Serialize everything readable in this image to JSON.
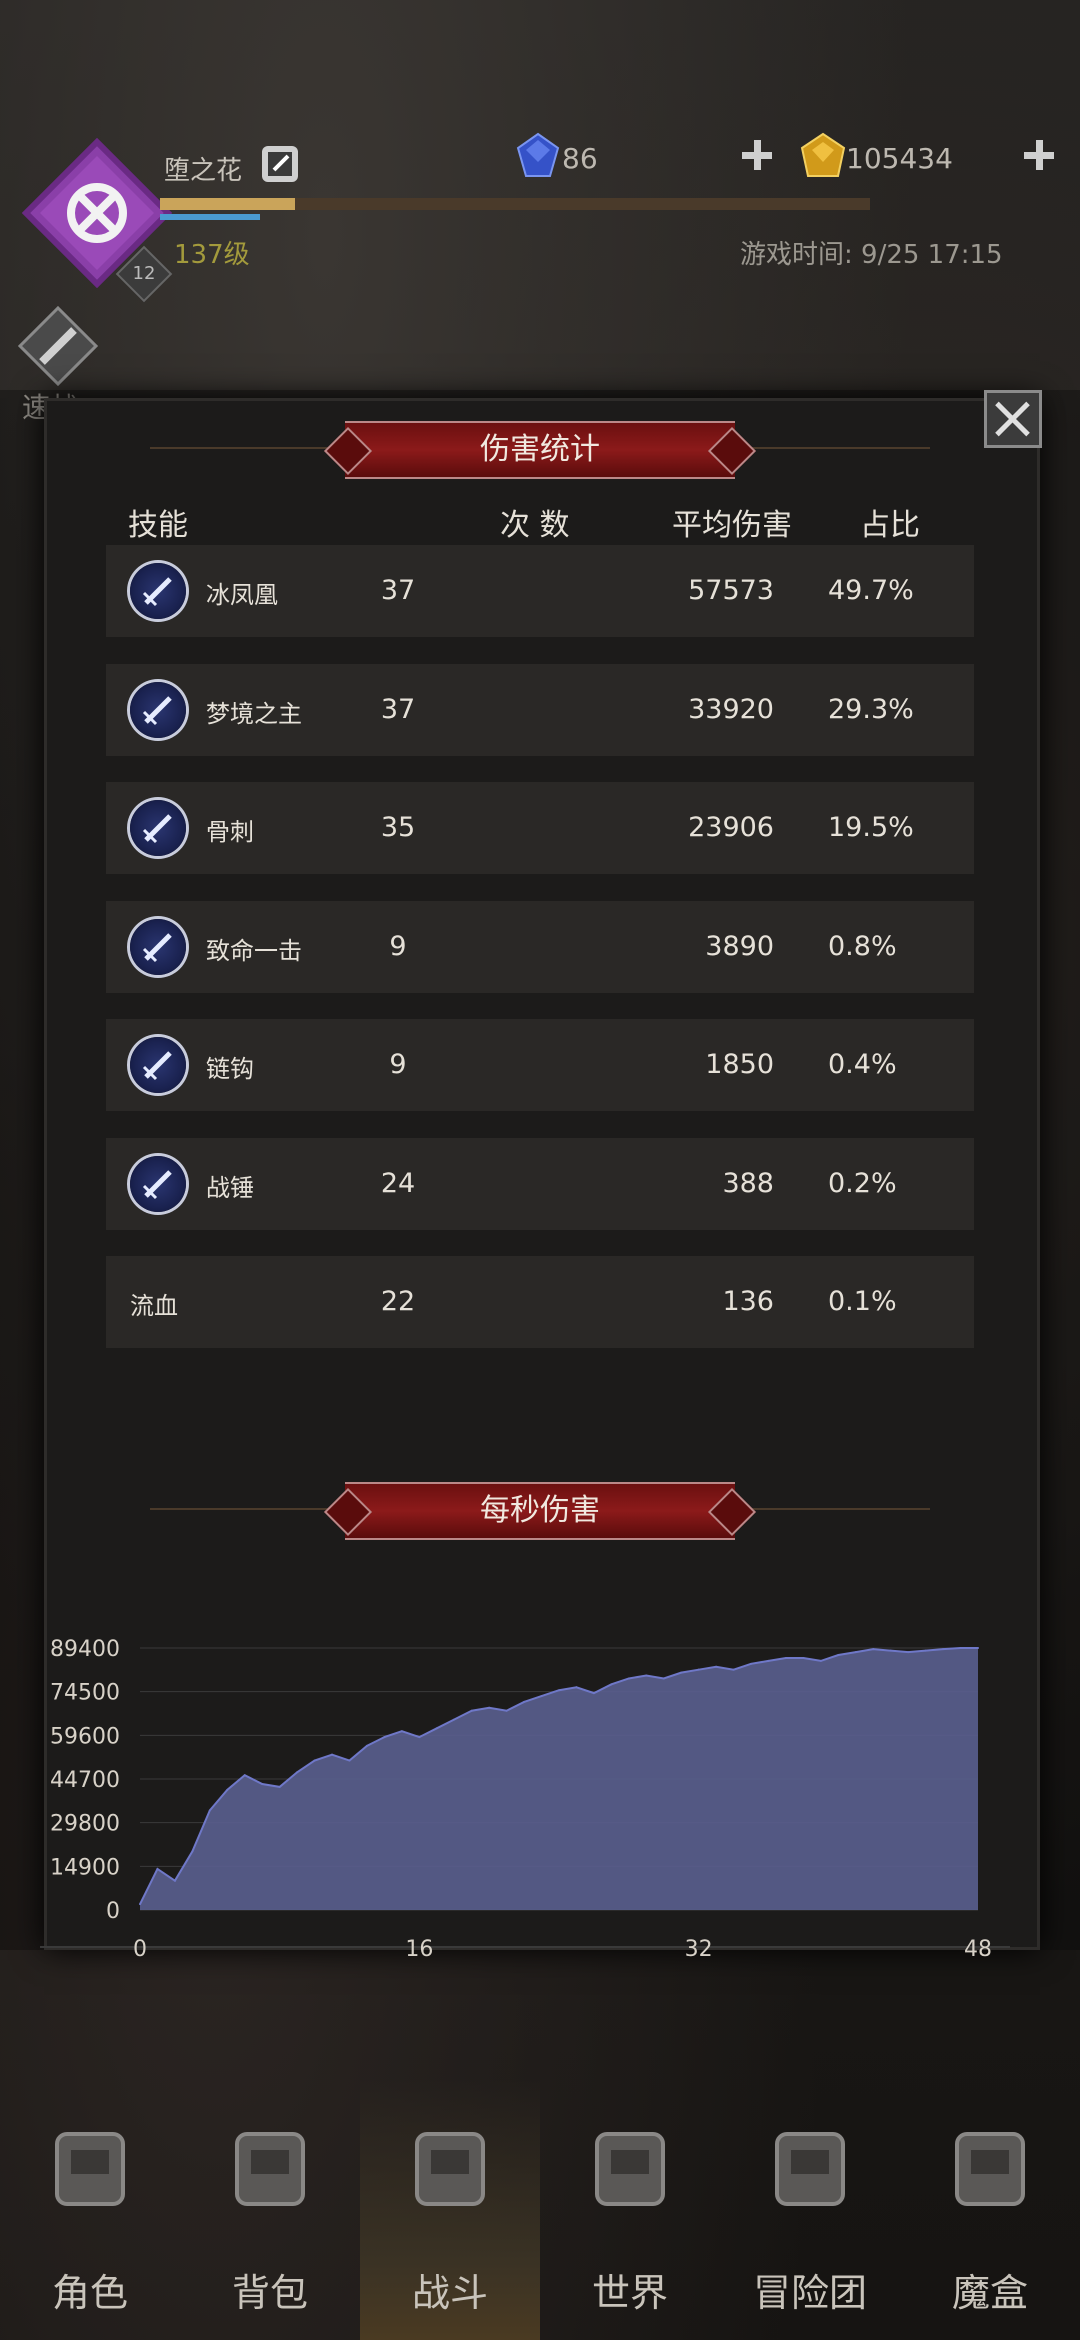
{
  "header": {
    "player_name": "堕之花",
    "level_text": "137级",
    "level_badge": "12",
    "gems": "86",
    "gold": "105434",
    "game_time": "游戏时间: 9/25 17:15",
    "quick_battle": "速战",
    "xp_progress": 0.19
  },
  "dialog": {
    "title": "伤害统计",
    "columns": {
      "skill": "技能",
      "count": "次 数",
      "avg": "平均伤害",
      "ratio": "占比"
    },
    "rows": [
      {
        "name": "冰凤凰",
        "count": "37",
        "avg": "57573",
        "ratio": "49.7%",
        "icon": "ice-phoenix-icon"
      },
      {
        "name": "梦境之主",
        "count": "37",
        "avg": "33920",
        "ratio": "29.3%",
        "icon": "sword-icon"
      },
      {
        "name": "骨刺",
        "count": "35",
        "avg": "23906",
        "ratio": "19.5%",
        "icon": "sword-icon"
      },
      {
        "name": "致命一击",
        "count": "9",
        "avg": "3890",
        "ratio": "0.8%",
        "icon": "critical-strike-icon"
      },
      {
        "name": "链钩",
        "count": "9",
        "avg": "1850",
        "ratio": "0.4%",
        "icon": "chain-hook-icon"
      },
      {
        "name": "战锤",
        "count": "24",
        "avg": "388",
        "ratio": "0.2%",
        "icon": "sword-icon"
      },
      {
        "name": "流血",
        "count": "22",
        "avg": "136",
        "ratio": "0.1%",
        "icon": ""
      }
    ],
    "dps_title": "每秒伤害"
  },
  "chart_data": {
    "type": "area",
    "title": "每秒伤害",
    "xlabel": "",
    "ylabel": "",
    "xlim": [
      0,
      48
    ],
    "ylim": [
      0,
      89400
    ],
    "xticks": [
      "0",
      "16",
      "32",
      "48"
    ],
    "yticks": [
      "0",
      "14900",
      "29800",
      "44700",
      "59600",
      "74500",
      "89400"
    ],
    "x": [
      0,
      1,
      2,
      3,
      4,
      5,
      6,
      7,
      8,
      9,
      10,
      11,
      12,
      13,
      14,
      15,
      16,
      17,
      18,
      19,
      20,
      21,
      22,
      23,
      24,
      25,
      26,
      27,
      28,
      29,
      30,
      31,
      32,
      33,
      34,
      35,
      36,
      37,
      38,
      39,
      40,
      41,
      42,
      43,
      44,
      45,
      46,
      47,
      48
    ],
    "values": [
      2000,
      14000,
      10000,
      20000,
      34000,
      41000,
      46000,
      43000,
      42000,
      47000,
      51000,
      53000,
      51000,
      56000,
      59000,
      61000,
      59000,
      62000,
      65000,
      68000,
      69000,
      68000,
      71000,
      73000,
      75000,
      76000,
      74000,
      77000,
      79000,
      80000,
      79000,
      81000,
      82000,
      83000,
      82000,
      84000,
      85000,
      86000,
      86000,
      85000,
      87000,
      88000,
      89000,
      88500,
      88000,
      88500,
      89000,
      89400,
      89400
    ],
    "fill_color": "#5a5f8f",
    "line_color": "#6f78c8",
    "grid": true
  },
  "nav": [
    {
      "label": "角色",
      "icon": "helmet-icon"
    },
    {
      "label": "背包",
      "icon": "backpack-icon"
    },
    {
      "label": "战斗",
      "icon": "battle-shield-icon"
    },
    {
      "label": "世界",
      "icon": "world-map-icon"
    },
    {
      "label": "冒险团",
      "icon": "castle-icon"
    },
    {
      "label": "魔盒",
      "icon": "magic-cube-icon"
    }
  ],
  "colors": {
    "accent_red": "#8c1a1a",
    "gold_text": "#a39a3c",
    "chart_fill": "#5a5f8f"
  }
}
